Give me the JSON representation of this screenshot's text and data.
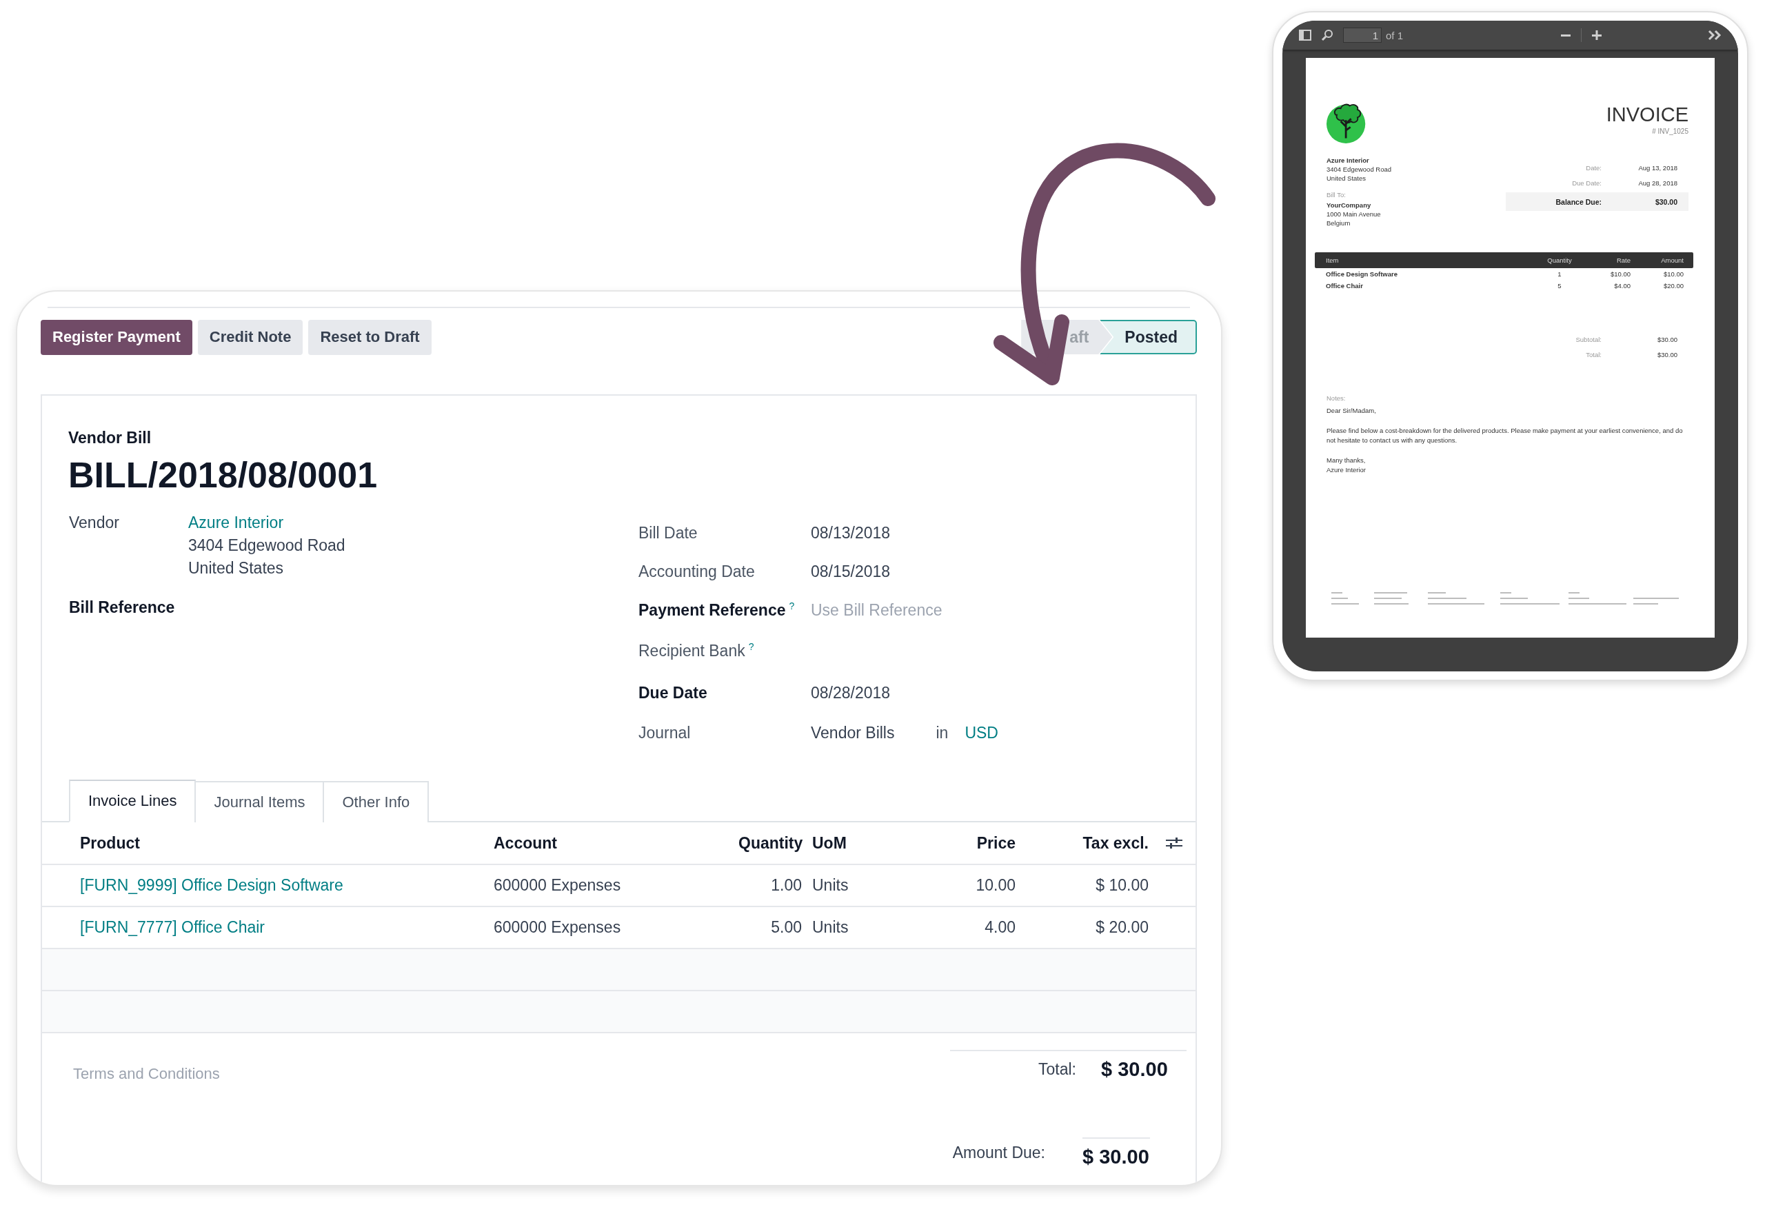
{
  "form": {
    "actions": [
      {
        "label": "Register Payment",
        "primary": true
      },
      {
        "label": "Credit Note",
        "primary": false
      },
      {
        "label": "Reset to Draft",
        "primary": false
      }
    ],
    "status_steps": [
      {
        "label": "aft",
        "selected": false
      },
      {
        "label": "Posted",
        "selected": true
      }
    ],
    "doc_type": "Vendor Bill",
    "title": "BILL/2018/08/0001",
    "vendor": {
      "label": "Vendor",
      "name": "Azure Interior",
      "address": [
        "3404 Edgewood Road",
        "United States"
      ]
    },
    "bill_reference": {
      "label": "Bill Reference"
    },
    "fields": [
      {
        "label": "Bill Date",
        "required": false,
        "value": "08/13/2018"
      },
      {
        "label": "Accounting Date",
        "required": false,
        "value": "08/15/2018"
      },
      {
        "label": "Payment Reference",
        "required": true,
        "help": "?",
        "placeholder": "Use Bill Reference"
      },
      {
        "label": "Recipient Bank",
        "required": false,
        "help": "?"
      },
      {
        "label": "Due Date",
        "required": true,
        "value": "08/28/2018"
      },
      {
        "label": "Journal",
        "required": false,
        "value": "Vendor Bills",
        "joiner": "in",
        "currency": "USD"
      }
    ],
    "tabs": [
      {
        "label": "Invoice Lines",
        "selected": true
      },
      {
        "label": "Journal Items",
        "selected": false
      },
      {
        "label": "Other Info",
        "selected": false
      }
    ],
    "table": {
      "columns": [
        "Product",
        "Account",
        "Quantity",
        "UoM",
        "Price",
        "Tax excl."
      ],
      "rows": [
        {
          "product": "[FURN_9999] Office Design Software",
          "account": "600000 Expenses",
          "quantity": "1.00",
          "uom": "Units",
          "price": "10.00",
          "tax_excl": "$ 10.00"
        },
        {
          "product": "[FURN_7777] Office Chair",
          "account": "600000 Expenses",
          "quantity": "5.00",
          "uom": "Units",
          "price": "4.00",
          "tax_excl": "$ 20.00"
        }
      ]
    },
    "terms": {
      "placeholder": "Terms and Conditions"
    },
    "totals": [
      {
        "label": "Total:",
        "value": "$ 30.00"
      },
      {
        "label": "Amount Due:",
        "value": "$ 30.00"
      }
    ]
  },
  "viewer": {
    "page_number": "1",
    "page_count": "of 1",
    "invoice": {
      "title": "INVOICE",
      "number": "# INV_1025",
      "from": [
        "Azure Interior",
        "3404 Edgewood Road",
        "United States"
      ],
      "bill_to_label": "Bill To:",
      "bill_to": [
        "YourCompany",
        "1000 Main Avenue",
        "Belgium"
      ],
      "meta": [
        {
          "label": "Date:",
          "value": "Aug 13, 2018"
        },
        {
          "label": "Due Date:",
          "value": "Aug 28, 2018"
        }
      ],
      "balance": {
        "label": "Balance Due:",
        "value": "$30.00"
      },
      "columns": [
        "Item",
        "Quantity",
        "Rate",
        "Amount"
      ],
      "rows": [
        {
          "item": "Office Design Software",
          "quantity": "1",
          "rate": "$10.00",
          "amount": "$10.00"
        },
        {
          "item": "Office Chair",
          "quantity": "5",
          "rate": "$4.00",
          "amount": "$20.00"
        }
      ],
      "summary": [
        {
          "label": "Subtotal:",
          "value": "$30.00"
        },
        {
          "label": "Total:",
          "value": "$30.00"
        }
      ],
      "notes_label": "Notes:",
      "notes": [
        "Dear Sir/Madam,",
        "Please find below a cost-breakdown for the delivered products. Please make payment at your earliest convenience, and do not hesitate to contact us with any questions.",
        "Many thanks,\nAzure Interior"
      ]
    }
  }
}
